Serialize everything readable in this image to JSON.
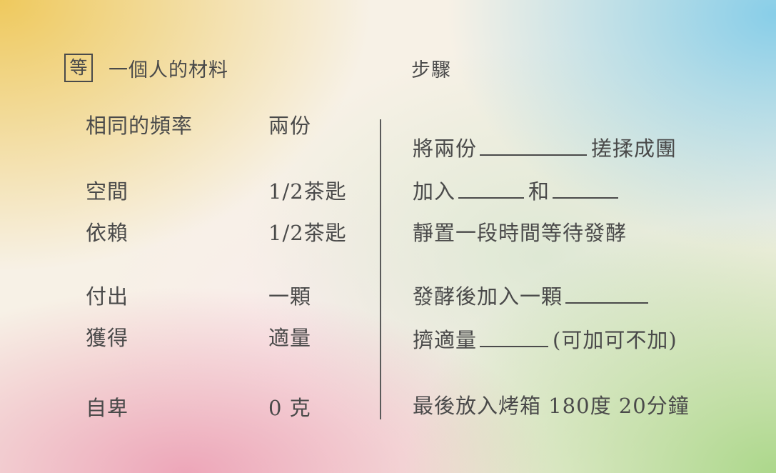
{
  "ingredients": {
    "badge": "等",
    "title": "一個人的材料",
    "rows": [
      {
        "name": "相同的頻率",
        "amount": "兩份"
      },
      {
        "name": "空間",
        "amount": "1/2茶匙"
      },
      {
        "name": "依賴",
        "amount": "1/2茶匙"
      },
      {
        "name": "付出",
        "amount": "一顆"
      },
      {
        "name": "獲得",
        "amount": "適量"
      },
      {
        "name": "自卑",
        "amount": "0 克"
      }
    ]
  },
  "steps": {
    "title": "步驟",
    "items": {
      "s1": {
        "a": "將兩份",
        "b": "搓揉成團"
      },
      "s2": {
        "a": "加入",
        "b": "和"
      },
      "s3": {
        "a": "靜置一段時間等待發酵"
      },
      "s4": {
        "a": "發酵後加入一顆"
      },
      "s5": {
        "a": "擠適量",
        "b": "(可加可不加)"
      },
      "s6": {
        "a": "最後放入烤箱 180度 20分鐘"
      }
    }
  }
}
